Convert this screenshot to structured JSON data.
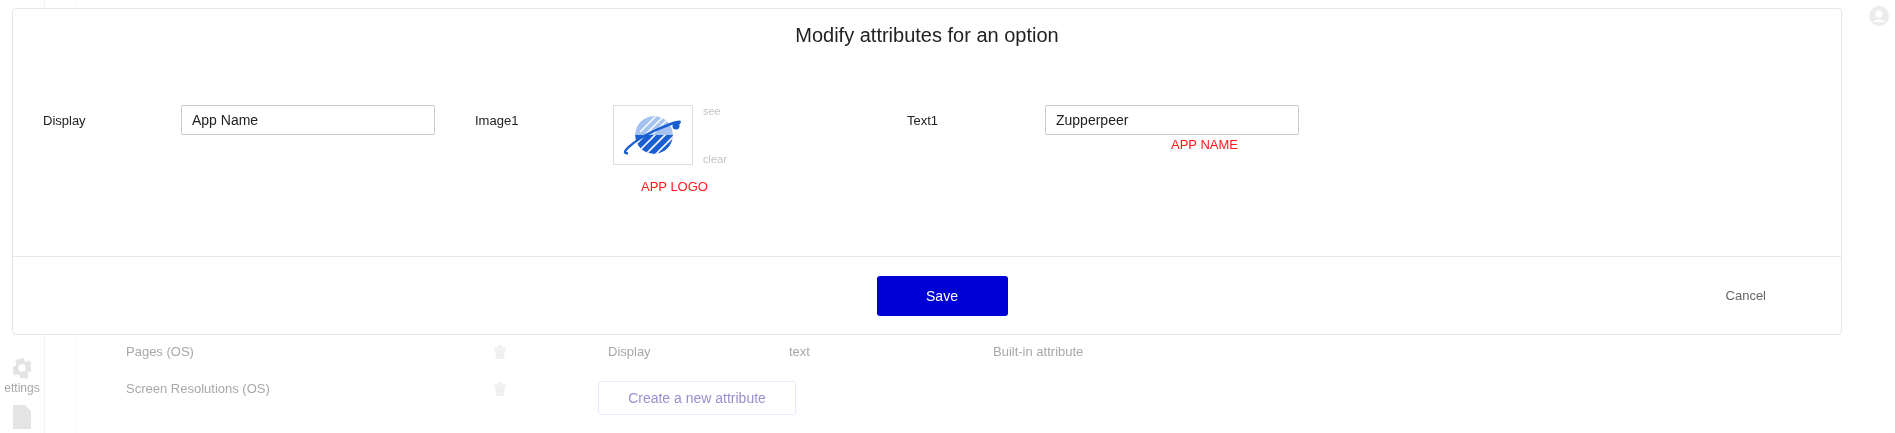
{
  "dialog": {
    "title": "Modify attributes for an option",
    "fields": [
      {
        "kind": "text",
        "label": "Display",
        "value": "App Name"
      },
      {
        "kind": "image",
        "label": "Image1",
        "actions": [
          "see",
          "clear"
        ],
        "note": "APP LOGO"
      },
      {
        "kind": "text",
        "label": "Text1",
        "value": "Zupperpeer",
        "note": "APP NAME"
      }
    ],
    "save_button": "Save",
    "cancel_button": "Cancel"
  },
  "background": {
    "sidebar": {
      "settings_label": "ettings"
    },
    "attribute_sets": [
      "Pages (OS)",
      "Screen Resolutions (OS)"
    ],
    "attribute": {
      "name": "Display",
      "type": "text",
      "note": "Built-in attribute"
    },
    "create_button": "Create a new attribute"
  }
}
